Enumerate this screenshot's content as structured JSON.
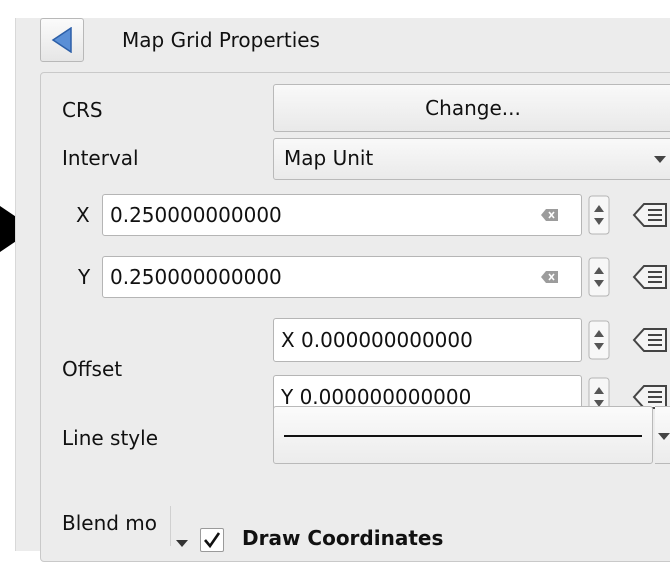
{
  "panel": {
    "title": "Map Grid Properties"
  },
  "crs": {
    "label": "CRS",
    "button": "Change..."
  },
  "interval": {
    "label": "Interval",
    "unit": "Map Unit",
    "x_label": "X",
    "x_value": "0.250000000000",
    "y_label": "Y",
    "y_value": "0.250000000000"
  },
  "offset": {
    "label": "Offset",
    "x_value": "X 0.000000000000",
    "y_value": "Y 0.000000000000"
  },
  "line_style": {
    "label": "Line style"
  },
  "blend_mode": {
    "label": "Blend mo"
  },
  "draw_coordinates": {
    "label": "Draw Coordinates",
    "checked": true
  }
}
